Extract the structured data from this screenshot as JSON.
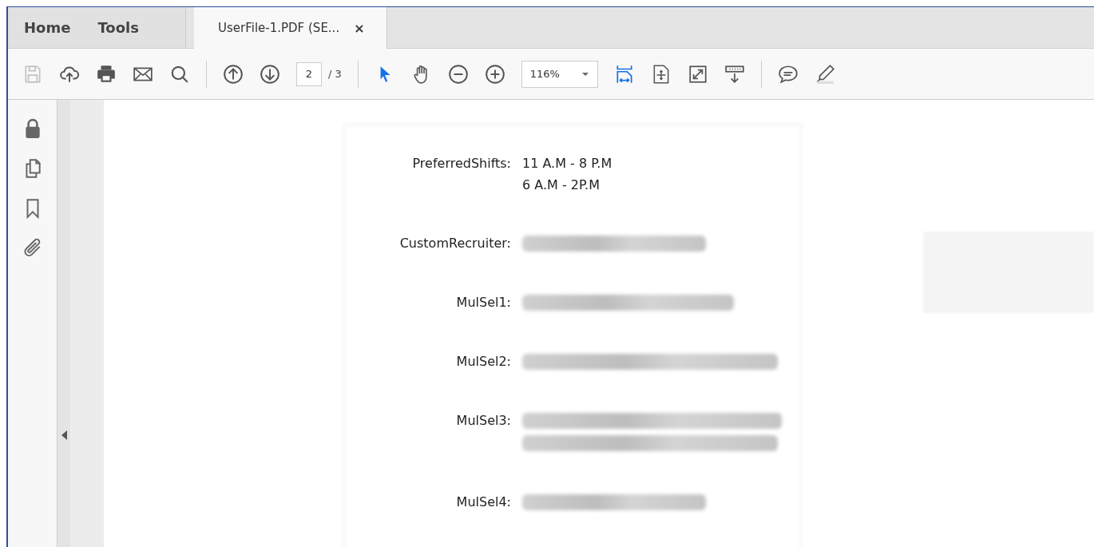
{
  "menu_tabs": [
    {
      "label": "Home"
    },
    {
      "label": "Tools"
    }
  ],
  "document_tab": {
    "title": "UserFile-1.PDF (SE...",
    "close": "×"
  },
  "toolbar": {
    "left": [
      {
        "kind": "save",
        "disabled": true
      },
      {
        "kind": "upload",
        "disabled": false
      },
      {
        "kind": "print",
        "disabled": false
      },
      {
        "kind": "mail",
        "disabled": false
      },
      {
        "kind": "search",
        "disabled": false
      }
    ],
    "nav": [
      {
        "kind": "prev-page"
      },
      {
        "kind": "next-page"
      }
    ],
    "page": {
      "value": "2",
      "total": "/ 3"
    },
    "tools": [
      {
        "kind": "select",
        "selected": true
      },
      {
        "kind": "hand",
        "selected": false
      },
      {
        "kind": "zoom-out",
        "selected": false
      },
      {
        "kind": "zoom-in",
        "selected": false
      }
    ],
    "zoom": {
      "value": "116%"
    },
    "view": [
      {
        "kind": "fit-width",
        "selected": true
      },
      {
        "kind": "fit-page",
        "selected": false
      },
      {
        "kind": "full-screen",
        "selected": false
      },
      {
        "kind": "read-mode",
        "selected": false
      }
    ],
    "annotate": [
      {
        "kind": "comment"
      },
      {
        "kind": "highlight"
      }
    ]
  },
  "side_rail": [
    {
      "kind": "lock"
    },
    {
      "kind": "pages"
    },
    {
      "kind": "bookmark"
    },
    {
      "kind": "attachment"
    }
  ],
  "fields": [
    {
      "label": "PreferredShifts:",
      "lines": [
        {
          "kind": "text",
          "text": "11 A.M - 8 P.M"
        },
        {
          "kind": "text",
          "text": "6 A.M - 2P.M"
        }
      ]
    },
    {
      "label": "CustomRecruiter:",
      "lines": [
        {
          "kind": "blurred"
        }
      ]
    },
    {
      "label": "MulSel1:",
      "lines": [
        {
          "kind": "blurred"
        }
      ]
    },
    {
      "label": "MulSel2:",
      "lines": [
        {
          "kind": "blurred"
        }
      ]
    },
    {
      "label": "MulSel3:",
      "lines": [
        {
          "kind": "blurred"
        },
        {
          "kind": "blurred"
        }
      ]
    },
    {
      "label": "MulSel4:",
      "lines": [
        {
          "kind": "blurred"
        }
      ]
    }
  ]
}
